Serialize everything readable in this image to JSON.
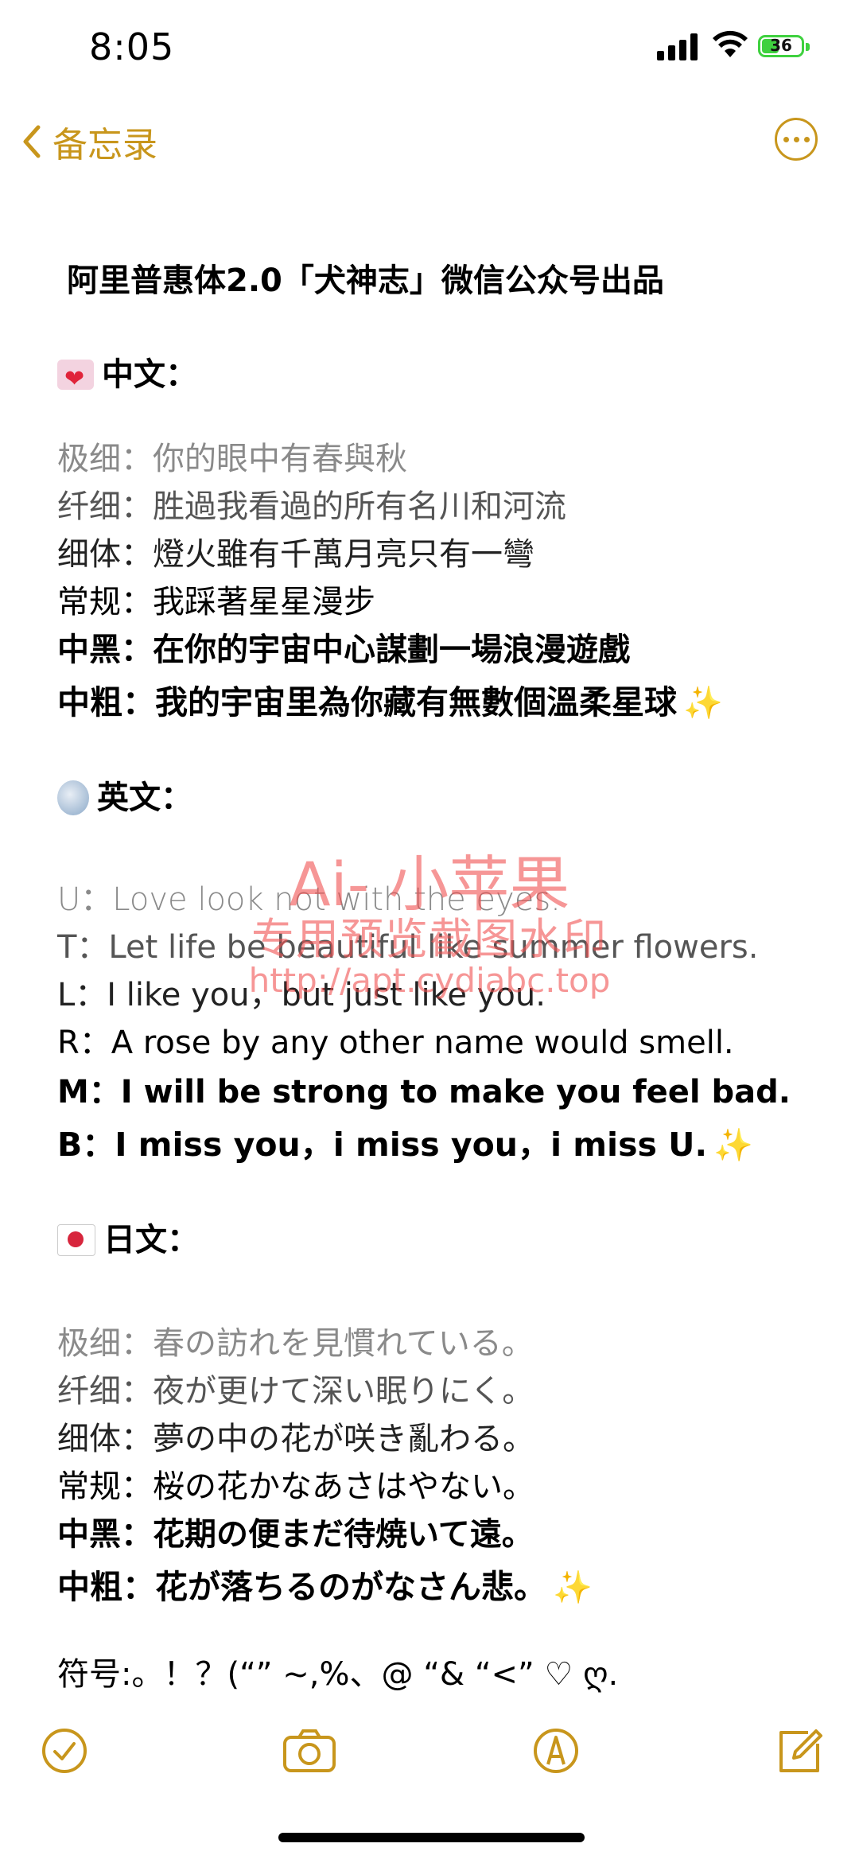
{
  "status": {
    "time": "8:05",
    "battery": "36"
  },
  "nav": {
    "back_label": "备忘录"
  },
  "title": "阿里普惠体2.0「犬神志」微信公众号出品",
  "chinese": {
    "header": "中文：",
    "lines": [
      "极细：你的眼中有春與秋",
      "纤细：胜過我看過的所有名川和河流",
      "细体：燈火雖有千萬月亮只有一彎",
      "常规：我踩著星星漫步",
      "中黑：在你的宇宙中心謀劃一場浪漫遊戲",
      "中粗：我的宇宙里為你藏有無數個溫柔星球"
    ]
  },
  "english": {
    "header": "英文：",
    "lines": [
      "U：Love look not with the eyes.",
      "T：Let life be beautiful like summer flowers.",
      "L：I like you，but just like you.",
      "R：A rose by any other name would smell.",
      "M：I will be strong to make you feel bad.",
      "B：I miss you，i miss you，i miss U."
    ]
  },
  "japanese": {
    "header": "日文：",
    "lines": [
      "极细：春の訪れを見慣れている。",
      "纤细：夜が更けて深い眠りにく。",
      "细体：夢の中の花が咲き亂わる。",
      "常规：桜の花かなあさはやない。",
      "中黑：花期の便まだ待焼いて遠。",
      "中粗：花が落ちるのがなさん悲。"
    ]
  },
  "symbols": "符号:。！？(“” ~,%、@ “& “<” ♡ ღ.",
  "watermark": {
    "line1": "Ai- 小苹果",
    "line2": "专用预览截图水印",
    "line3": "http://apt.cydiabc.top"
  },
  "icons": {
    "sparkle": "✨",
    "back": "chevron-left-icon",
    "more": "ellipsis-circle-icon",
    "checklist": "checkmark-circle-icon",
    "camera": "camera-icon",
    "markup": "pen-tip-circle-icon",
    "compose": "compose-icon"
  },
  "colors": {
    "accent": "#c8961c",
    "watermark": "#f05050",
    "battery": "#3fd13f"
  }
}
